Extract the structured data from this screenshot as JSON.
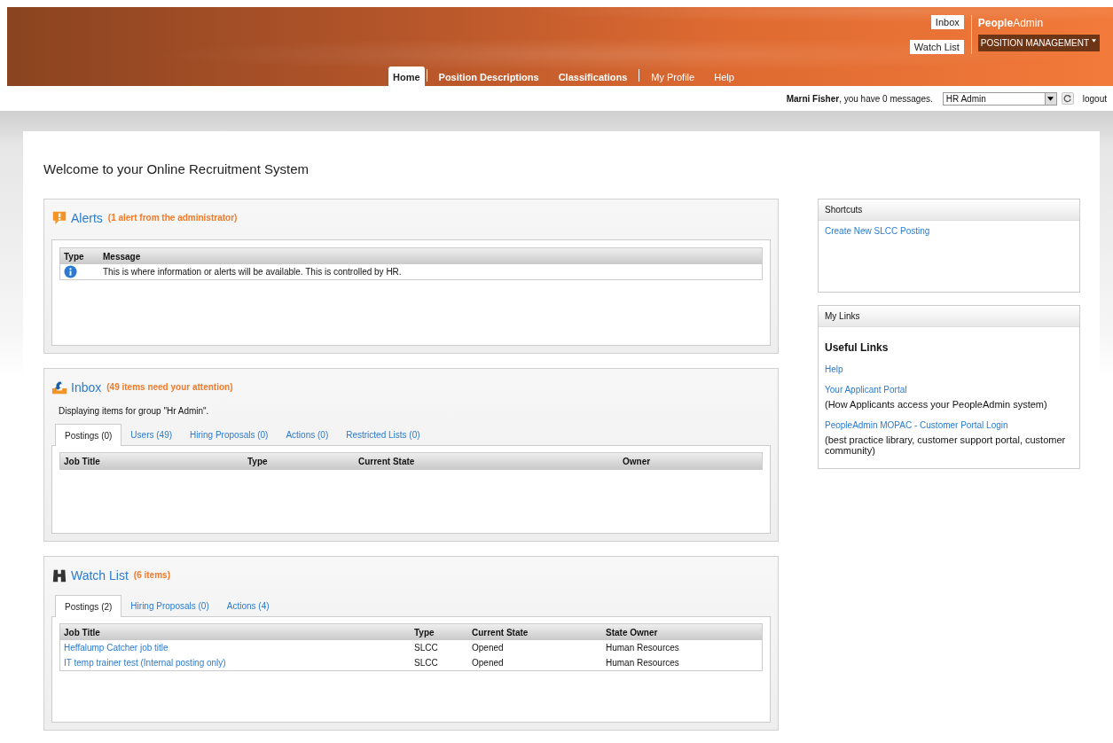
{
  "header": {
    "links": [
      "Inbox",
      "Watch List"
    ],
    "logo": "**People**Admin",
    "module_menu": "POSITION MANAGEMENT"
  },
  "nav": [
    {
      "label": "Home",
      "selected": true
    },
    {
      "label": "Position Descriptions",
      "selected": false
    },
    {
      "label": "Classifications",
      "selected": false
    },
    {
      "label": "My Profile",
      "selected": false
    },
    {
      "label": "Help",
      "selected": false
    }
  ],
  "user_bar": {
    "greeting": "**Marni Fisher**, you have 0 messages.",
    "role": "HR Admin",
    "logout": "logout"
  },
  "page_title": "Welcome to your Online Recruitment System",
  "panels": [
    {
      "kind": "alert",
      "title": "Alerts",
      "subtitle": "(1 alert from the administrator)",
      "columns": [
        "Type",
        "Message"
      ],
      "rows": [
        {
          "kind": "info",
          "cells": [
            "",
            "This is where information or alerts will be available. This is controlled by HR."
          ]
        }
      ]
    },
    {
      "kind": "inbox",
      "title": "Inbox",
      "subtitle": "(49 items need your attention)",
      "note": "Displaying items for group \"Hr Admin\".",
      "tabs": [
        {
          "label": "Postings (0)",
          "selected": true
        },
        {
          "label": "Users (49)",
          "selected": false
        },
        {
          "label": "Hiring Proposals (0)",
          "selected": false
        },
        {
          "label": "Actions (0)",
          "selected": false
        },
        {
          "label": "Restricted Lists (0)",
          "selected": false
        }
      ],
      "columns": [
        "Job Title",
        "Type",
        "Current State",
        "Owner"
      ]
    },
    {
      "kind": "watch",
      "title": "Watch List",
      "subtitle": "(6 items)",
      "tabs": [
        {
          "label": "Postings (2)",
          "selected": true
        },
        {
          "label": "Hiring Proposals (0)",
          "selected": false
        },
        {
          "label": "Actions (4)",
          "selected": false
        }
      ],
      "columns": [
        "Job Title",
        "Type",
        "Current State",
        "State Owner"
      ],
      "rows": [
        {
          "kind": "link",
          "cells": [
            "Heffalump Catcher job title",
            "SLCC",
            "Opened",
            "Human Resources"
          ]
        },
        {
          "kind": "link",
          "cells": [
            "IT temp trainer test (Internal posting only)",
            "SLCC",
            "Opened",
            "Human Resources"
          ]
        }
      ]
    }
  ],
  "shortcuts": {
    "title": "Shortcuts",
    "links": [
      "Create New SLCC Posting"
    ]
  },
  "my_links": {
    "title": "My Links",
    "heading": "Useful Links",
    "items": [
      {
        "link": "Help"
      },
      {
        "link": "Your Applicant Portal",
        "description": "(How Applicants access your PeopleAdmin system)"
      },
      {
        "link": "PeopleAdmin MOPAC - Customer Portal Login",
        "description": " (best practice library, customer support portal, customer community)"
      }
    ]
  }
}
